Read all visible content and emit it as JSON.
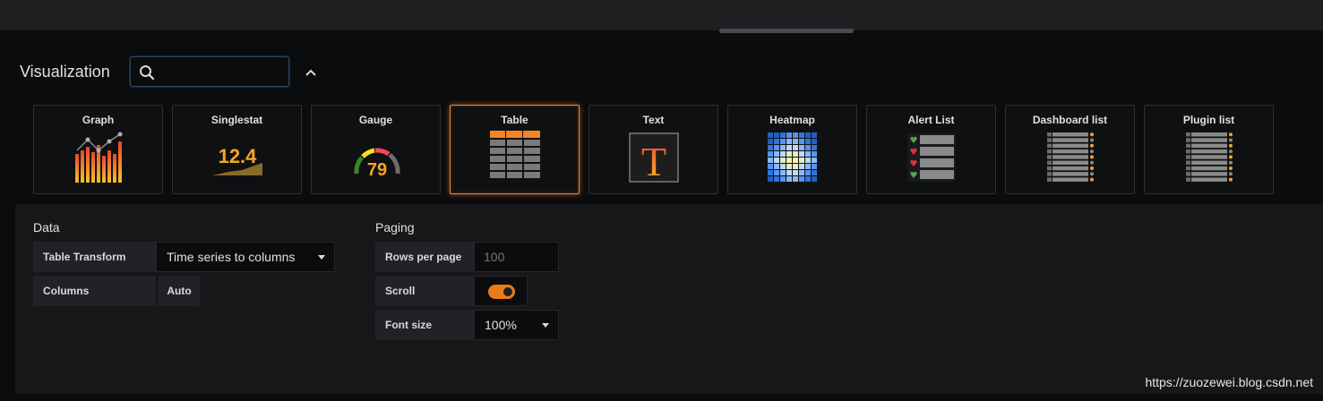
{
  "visualization": {
    "title": "Visualization",
    "search": {
      "value": "",
      "placeholder": ""
    },
    "cards": [
      {
        "label": "Graph",
        "icon": "graph-icon",
        "selected": false
      },
      {
        "label": "Singlestat",
        "icon": "singlestat-icon",
        "icon_text": "12.4",
        "selected": false
      },
      {
        "label": "Gauge",
        "icon": "gauge-icon",
        "icon_text": "79",
        "selected": false
      },
      {
        "label": "Table",
        "icon": "table-icon",
        "selected": true
      },
      {
        "label": "Text",
        "icon": "text-icon",
        "icon_text": "T",
        "selected": false
      },
      {
        "label": "Heatmap",
        "icon": "heatmap-icon",
        "selected": false
      },
      {
        "label": "Alert List",
        "icon": "alert-list-icon",
        "selected": false
      },
      {
        "label": "Dashboard list",
        "icon": "dashboard-list-icon",
        "selected": false
      },
      {
        "label": "Plugin list",
        "icon": "plugin-list-icon",
        "selected": false
      }
    ]
  },
  "data_section": {
    "heading": "Data",
    "table_transform_label": "Table Transform",
    "table_transform_value": "Time series to columns",
    "columns_label": "Columns",
    "columns_button": "Auto"
  },
  "paging_section": {
    "heading": "Paging",
    "rows_per_page_label": "Rows per page",
    "rows_per_page_placeholder": "100",
    "scroll_label": "Scroll",
    "scroll_enabled": true,
    "font_size_label": "Font size",
    "font_size_value": "100%"
  },
  "watermark": "https://zuozewei.blog.csdn.net",
  "colors": {
    "accent": "#f38428",
    "toggle_on": "#eb7b18",
    "focus_border": "#2d4461"
  }
}
